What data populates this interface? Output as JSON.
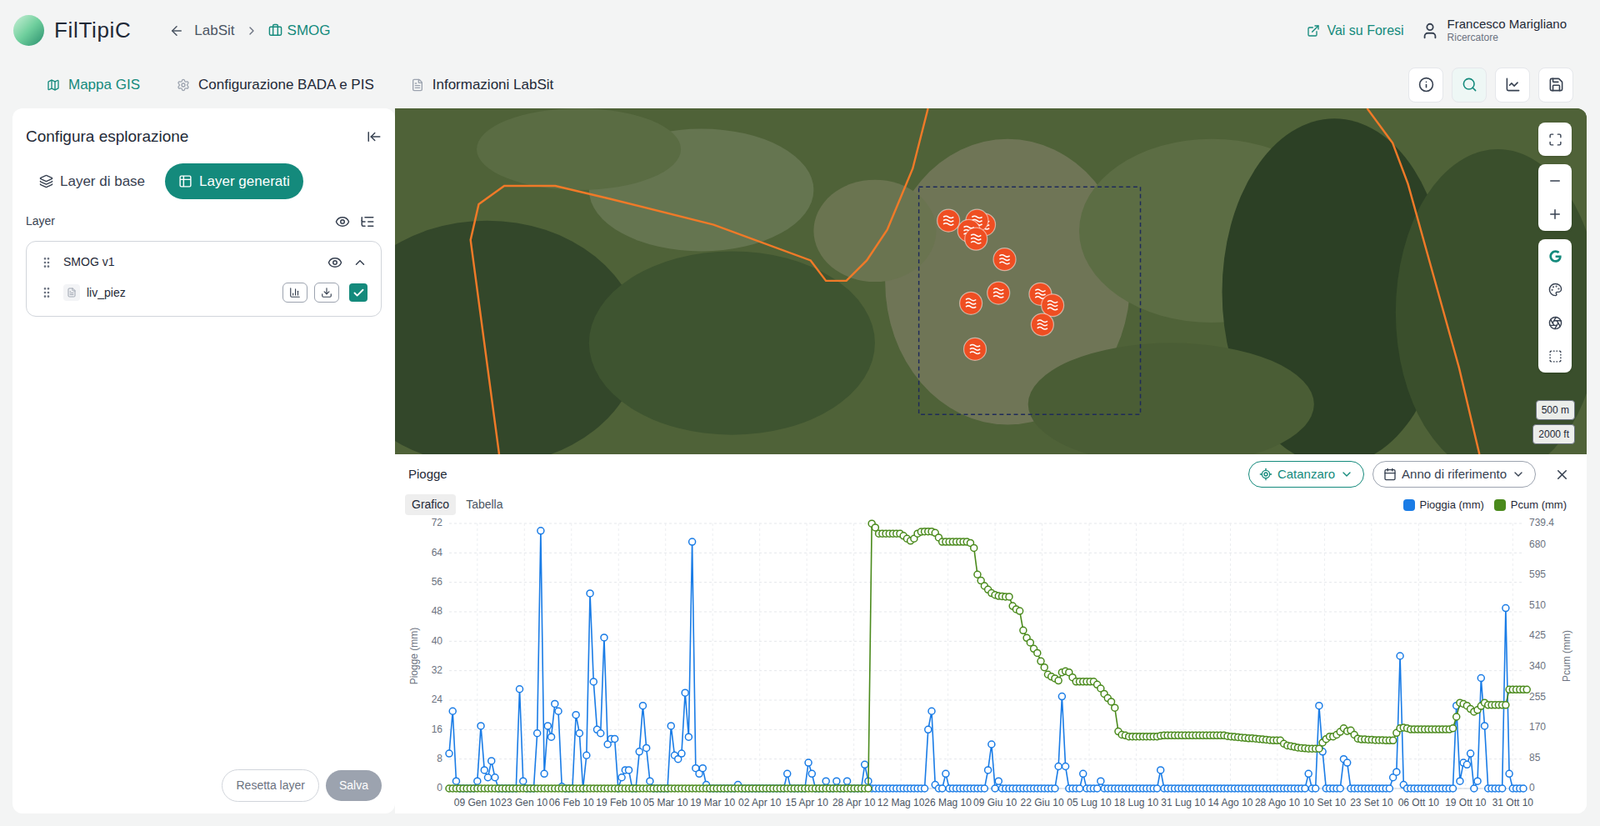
{
  "app": {
    "logo": "FilTipiC"
  },
  "breadcrumb": [
    {
      "label": "LabSit",
      "selected": false
    },
    {
      "label": "SMOG",
      "selected": true
    }
  ],
  "header_actions": {
    "link": "Vai su Foresi",
    "user": {
      "name": "Francesco Marigliano",
      "role": "Ricercatore"
    }
  },
  "nav_tabs": [
    {
      "label": "Mappa GIS",
      "kind": "map",
      "selected": true
    },
    {
      "label": "Configurazione BADA e PIS",
      "kind": "config",
      "selected": false
    },
    {
      "label": "Informazioni LabSit",
      "kind": "info",
      "selected": false
    }
  ],
  "toolbar_buttons": [
    {
      "kind": "info",
      "selected": false
    },
    {
      "kind": "search",
      "selected": true
    },
    {
      "kind": "chart",
      "selected": false
    },
    {
      "kind": "export",
      "selected": false
    }
  ],
  "sidebar": {
    "title": "Configura esplorazione",
    "layer_tabs": [
      {
        "label": "Layer di base",
        "kind": "base",
        "selected": false
      },
      {
        "label": "Layer generati",
        "kind": "generated",
        "selected": true
      }
    ],
    "layers_label": "Layer",
    "groups": [
      {
        "name": "SMOG v1",
        "visible": true,
        "expanded": true,
        "layers": [
          {
            "name": "liv_piez",
            "checked": true
          }
        ]
      }
    ],
    "buttons": [
      {
        "label": "Resetta layer",
        "disabled": false
      },
      {
        "label": "Salva",
        "disabled": true
      }
    ]
  },
  "map": {
    "markers": [
      {
        "kind": "piezometer"
      },
      {
        "kind": "piezometer"
      },
      {
        "kind": "piezometer"
      },
      {
        "kind": "piezometer"
      },
      {
        "kind": "piezometer"
      },
      {
        "kind": "piezometer"
      },
      {
        "kind": "piezometer"
      },
      {
        "kind": "piezometer"
      },
      {
        "kind": "piezometer"
      },
      {
        "kind": "piezometer"
      },
      {
        "kind": "piezometer"
      },
      {
        "kind": "piezometer"
      }
    ],
    "scale": [
      "500 m",
      "2000 ft"
    ]
  },
  "chart_panel": {
    "title": "Piogge",
    "location": "Catanzaro",
    "period": "Anno di riferimento",
    "views": [
      {
        "label": "Grafico",
        "selected": true
      },
      {
        "label": "Tabella",
        "selected": false
      }
    ],
    "chart": {
      "left_axis": {
        "title": "Piogge (mm)",
        "ticks": [
          "0",
          "8",
          "16",
          "24",
          "32",
          "40",
          "48",
          "56",
          "64",
          "72"
        ]
      },
      "right_axis": {
        "title": "Pcum (mm)",
        "ticks": [
          "0",
          "85",
          "170",
          "255",
          "340",
          "425",
          "510",
          "595",
          "680",
          "739.4"
        ]
      },
      "x_labels": [
        "09 Gen 10",
        "23 Gen 10",
        "06 Feb 10",
        "19 Feb 10",
        "05 Mar 10",
        "19 Mar 10",
        "02 Apr 10",
        "15 Apr 10",
        "28 Apr 10",
        "12 Mag 10",
        "26 Mag 10",
        "09 Giu 10",
        "22 Giu 10",
        "05 Lug 10",
        "18 Lug 10",
        "31 Lug 10",
        "14 Ago 10",
        "28 Ago 10",
        "10 Set 10",
        "23 Set 10",
        "06 Ott 10",
        "19 Ott 10",
        "31 Ott 10"
      ],
      "legend": [
        {
          "label": "Pioggia (mm)",
          "axis": "left",
          "color": "#1a7ce6",
          "values": [
            9.5,
            21,
            2,
            0,
            0,
            0,
            0,
            0,
            2,
            17,
            5,
            3,
            7.5,
            3,
            0,
            0,
            0,
            0,
            0,
            0,
            27,
            2,
            0,
            0,
            0,
            15,
            70,
            4,
            17,
            14,
            23,
            21,
            0.5,
            0,
            0,
            0,
            20,
            15,
            0,
            9,
            53,
            29,
            16,
            15,
            41,
            12,
            13.5,
            13.5,
            0,
            3,
            5,
            5,
            0,
            0,
            10,
            22.5,
            11,
            2,
            0,
            0,
            0,
            0,
            0,
            17,
            9,
            8,
            9.5,
            26,
            14,
            67,
            5.5,
            4,
            5.5,
            1,
            0,
            0,
            0,
            0,
            0,
            0,
            0,
            0,
            1,
            0,
            0,
            0,
            0,
            0,
            0,
            0,
            0,
            0,
            0,
            0,
            0,
            0,
            4,
            0,
            0,
            0,
            0,
            0,
            7,
            4,
            0,
            0,
            0,
            2,
            0,
            0,
            2,
            0,
            0,
            2,
            0,
            0,
            0,
            0,
            6.5,
            2,
            0,
            0,
            0,
            0,
            0,
            0,
            0,
            0,
            0,
            0,
            0,
            0,
            0,
            0,
            0,
            0,
            16,
            21,
            1,
            0,
            0,
            4,
            0,
            0,
            0,
            0,
            0,
            0,
            0,
            0,
            0,
            0,
            0,
            5,
            12,
            0,
            2,
            0,
            0,
            0,
            0,
            0,
            0,
            0,
            0,
            0,
            0,
            0,
            0,
            0,
            0,
            0,
            0,
            6,
            25,
            6,
            0,
            0,
            0,
            0,
            4,
            0,
            0,
            0,
            0,
            2,
            0,
            0,
            0,
            0,
            0,
            0,
            0,
            0,
            0,
            0,
            0,
            0,
            0,
            0,
            0,
            0,
            5,
            0,
            0,
            0,
            0,
            0,
            0,
            0,
            0,
            0,
            0,
            0,
            0,
            0,
            0,
            0,
            0,
            0,
            0,
            0,
            0,
            0,
            0,
            0,
            0,
            0,
            0,
            0,
            0,
            0,
            0,
            0,
            0,
            0,
            0,
            0,
            0,
            0,
            0,
            0,
            0,
            0,
            4,
            0,
            0,
            22.5,
            10,
            0,
            0,
            0,
            0,
            0,
            8,
            7,
            0,
            0,
            0,
            0,
            0,
            0,
            0,
            0,
            0,
            0,
            0,
            0,
            3,
            4.5,
            36,
            1,
            0,
            0,
            0,
            0,
            0,
            0,
            0,
            0,
            0,
            0,
            0,
            0,
            0,
            0,
            22.5,
            2,
            7,
            6.5,
            9.5,
            0,
            2,
            30,
            17,
            0,
            0,
            0,
            0,
            0,
            49,
            4,
            0,
            0,
            0,
            0
          ]
        },
        {
          "label": "Pcum (mm)",
          "axis": "right",
          "color": "#4a8a1c",
          "values": [
            0,
            0,
            0,
            0,
            0,
            0,
            0,
            0,
            0,
            0,
            0,
            0,
            0,
            0,
            0,
            0,
            0,
            0,
            0,
            0,
            0,
            0,
            0,
            0,
            0,
            0,
            0,
            0,
            0,
            0,
            0,
            0,
            0,
            0,
            0,
            0,
            0,
            0,
            0,
            0,
            0,
            0,
            0,
            0,
            0,
            0,
            0,
            0,
            0,
            0,
            0,
            0,
            0,
            0,
            0,
            0,
            0,
            0,
            0,
            0,
            0,
            0,
            0,
            0,
            0,
            0,
            0,
            0,
            0,
            0,
            0,
            0,
            0,
            0,
            0,
            0,
            0,
            0,
            0,
            0,
            0,
            0,
            0,
            0,
            0,
            0,
            0,
            0,
            0,
            0,
            0,
            0,
            0,
            0,
            0,
            0,
            0,
            0,
            0,
            0,
            0,
            0,
            0,
            0,
            0,
            0,
            0,
            0,
            0,
            0,
            0,
            0,
            0,
            0,
            0,
            0,
            0,
            0,
            0,
            0,
            739,
            728,
            711,
            711,
            711,
            711,
            711,
            711,
            711,
            705,
            697,
            691,
            697,
            711,
            716,
            717,
            717,
            717,
            713,
            700,
            688,
            688,
            688,
            688,
            688,
            688,
            688,
            688,
            685,
            671,
            597,
            580,
            565,
            555,
            545,
            540,
            537,
            536,
            535,
            535,
            509,
            500,
            495,
            441,
            420,
            407,
            390,
            378,
            355,
            338,
            318,
            312,
            307,
            301,
            324,
            327,
            324,
            310,
            298,
            298,
            298,
            298,
            298,
            298,
            290,
            279,
            264,
            252,
            242,
            225,
            159,
            150,
            148,
            145,
            145,
            145,
            145,
            145,
            145,
            145,
            145,
            145,
            147,
            148,
            148,
            148,
            148,
            148,
            148,
            148,
            148,
            148,
            148,
            148,
            148,
            148,
            148,
            148,
            148,
            148,
            148,
            146,
            145,
            144,
            143,
            142,
            141,
            140,
            140,
            139,
            138,
            137,
            136,
            135,
            134,
            134,
            134,
            125,
            120,
            118,
            116,
            114,
            113,
            112,
            111,
            111,
            111,
            111,
            128,
            138,
            145,
            145,
            150,
            158,
            168,
            160,
            162,
            150,
            139,
            137,
            137,
            136,
            136,
            135,
            135,
            135,
            134,
            134,
            134,
            155,
            168,
            170,
            168,
            165,
            165,
            165,
            165,
            165,
            165,
            165,
            165,
            165,
            165,
            165,
            165,
            168,
            200,
            239,
            236,
            231,
            222,
            214,
            219,
            230,
            239,
            233,
            233,
            233,
            233,
            233,
            233,
            276,
            276,
            276,
            276,
            276,
            276
          ]
        }
      ]
    }
  }
}
